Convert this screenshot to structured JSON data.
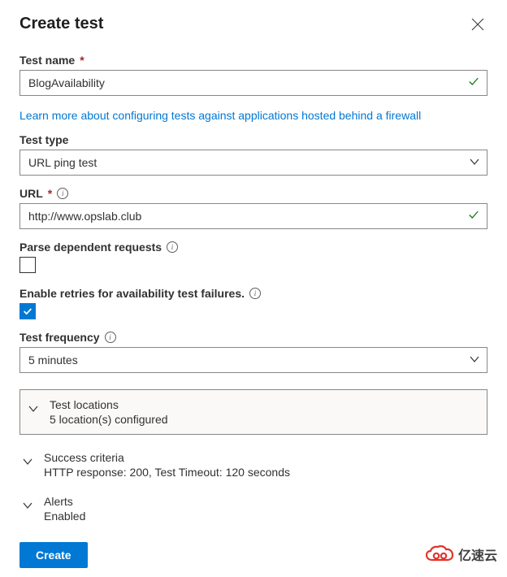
{
  "header": {
    "title": "Create test"
  },
  "testName": {
    "label": "Test name",
    "value": "BlogAvailability",
    "valid": true
  },
  "helpLink": "Learn more about configuring tests against applications hosted behind a firewall",
  "testType": {
    "label": "Test type",
    "value": "URL ping test"
  },
  "url": {
    "label": "URL",
    "value": "http://www.opslab.club",
    "valid": true
  },
  "parseDependent": {
    "label": "Parse dependent requests",
    "checked": false
  },
  "enableRetries": {
    "label": "Enable retries for availability test failures.",
    "checked": true
  },
  "testFrequency": {
    "label": "Test frequency",
    "value": "5 minutes"
  },
  "sections": {
    "locations": {
      "title": "Test locations",
      "subtitle": "5 location(s) configured"
    },
    "success": {
      "title": "Success criteria",
      "subtitle": "HTTP response: 200, Test Timeout: 120 seconds"
    },
    "alerts": {
      "title": "Alerts",
      "subtitle": "Enabled"
    }
  },
  "actions": {
    "create": "Create"
  },
  "watermark": "亿速云"
}
